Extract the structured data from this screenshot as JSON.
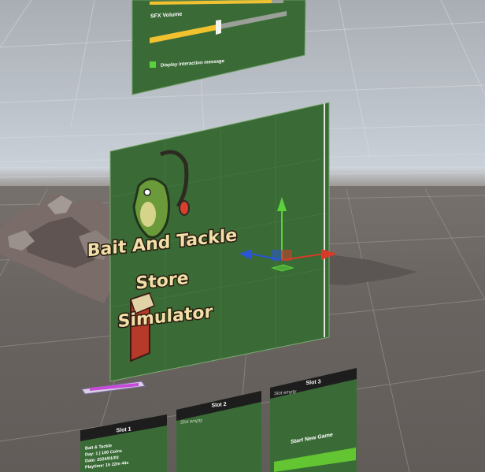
{
  "scene": {
    "settings_panel": {
      "slider_1_value": 0.92,
      "slider_2_label": "SFX Volume",
      "slider_2_value": 0.5,
      "toggle_label": "Display interaction message",
      "toggle_checked": true
    },
    "title_panel": {
      "title_line_1": "Bait And Tackle",
      "title_line_2": "Store",
      "title_line_3": "Simulator"
    },
    "slot_panels": [
      {
        "header": "Slot 1",
        "lines": [
          "Bait & Tackle",
          "Day: 1 | 100 Coins",
          "Date: 2024/01/03",
          "Playtime: 1h 22m 44s"
        ]
      },
      {
        "header": "Slot 2",
        "empty_text": "Slot empty"
      },
      {
        "header": "Slot 3",
        "empty_text": "Slot empty",
        "button_label": "Start New Game"
      }
    ],
    "colors": {
      "panel_green": "#3a6b36",
      "slider_fill": "#f2c12e",
      "gizmo_x": "#d63b2a",
      "gizmo_y": "#5bd13c",
      "gizmo_z": "#2a55d6",
      "button_green": "#63c531"
    }
  }
}
